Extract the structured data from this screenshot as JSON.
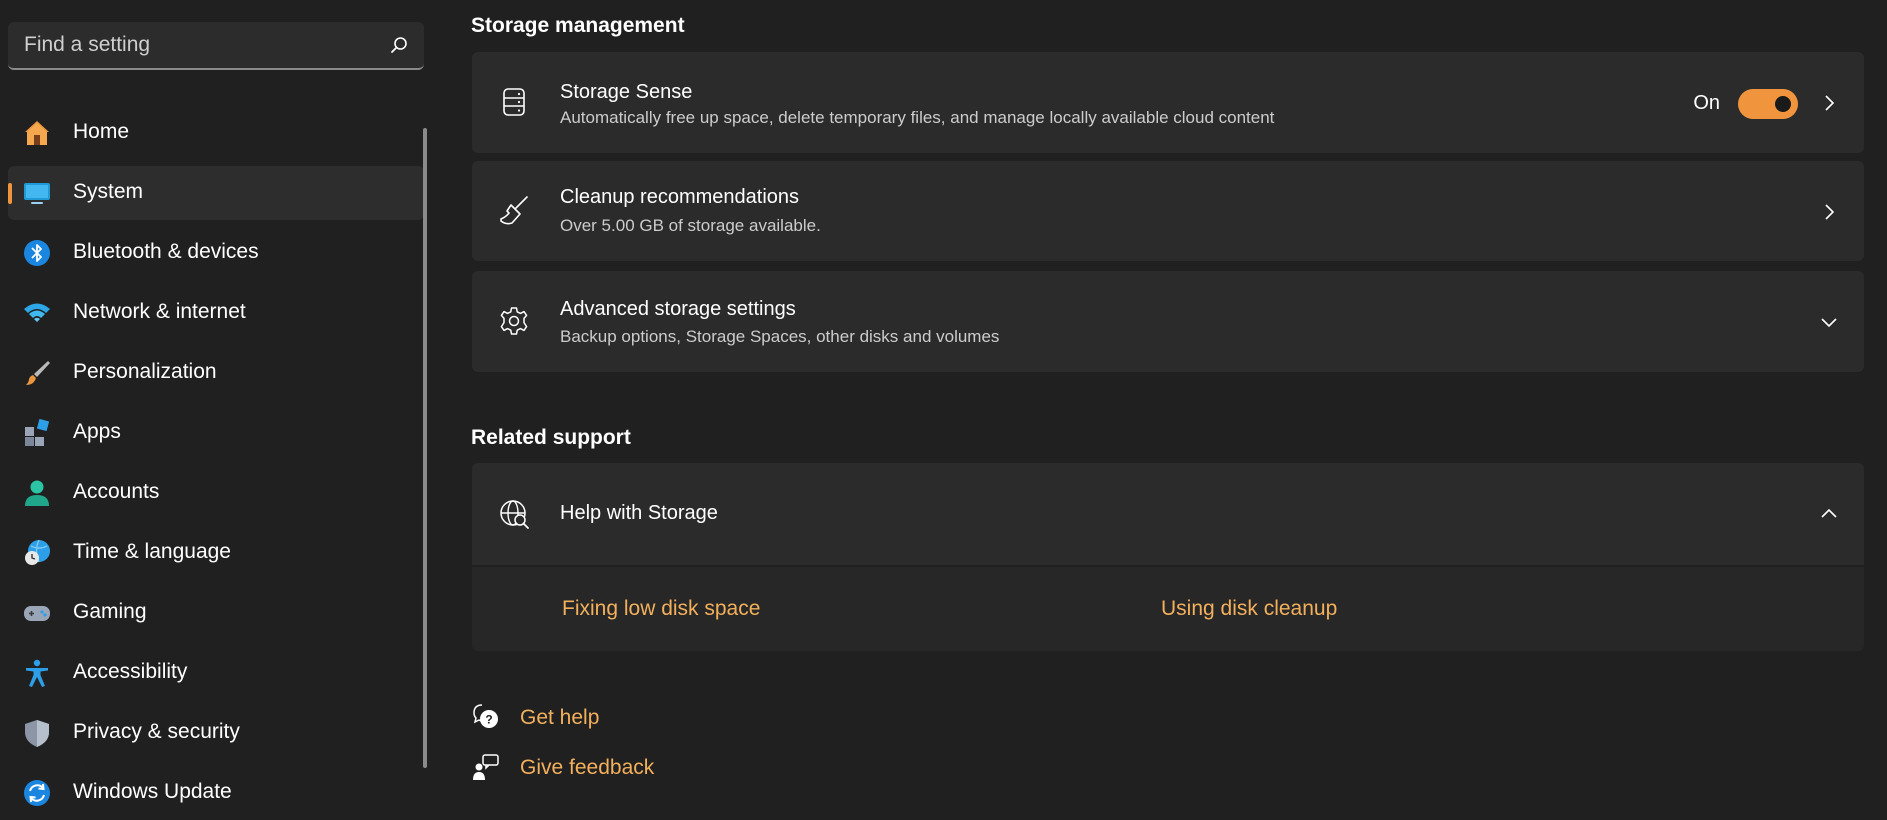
{
  "search": {
    "placeholder": "Find a setting"
  },
  "sidebar": {
    "items": [
      {
        "label": "Home",
        "icon": "home-icon"
      },
      {
        "label": "System",
        "icon": "system-icon",
        "selected": true
      },
      {
        "label": "Bluetooth & devices",
        "icon": "bluetooth-icon"
      },
      {
        "label": "Network & internet",
        "icon": "wifi-icon"
      },
      {
        "label": "Personalization",
        "icon": "brush-icon"
      },
      {
        "label": "Apps",
        "icon": "apps-icon"
      },
      {
        "label": "Accounts",
        "icon": "account-icon"
      },
      {
        "label": "Time & language",
        "icon": "globe-clock-icon"
      },
      {
        "label": "Gaming",
        "icon": "gamepad-icon"
      },
      {
        "label": "Accessibility",
        "icon": "accessibility-icon"
      },
      {
        "label": "Privacy & security",
        "icon": "shield-icon"
      },
      {
        "label": "Windows Update",
        "icon": "update-icon"
      }
    ]
  },
  "storage_management": {
    "title": "Storage management",
    "storage_sense": {
      "title": "Storage Sense",
      "description": "Automatically free up space, delete temporary files, and manage locally available cloud content",
      "toggle_label": "On"
    },
    "cleanup": {
      "title": "Cleanup recommendations",
      "description": "Over 5.00 GB of storage available."
    },
    "advanced": {
      "title": "Advanced storage settings",
      "description": "Backup options, Storage Spaces, other disks and volumes"
    }
  },
  "related_support": {
    "title": "Related support",
    "help": {
      "title": "Help with Storage",
      "links": [
        "Fixing low disk space",
        "Using disk cleanup"
      ]
    }
  },
  "footer": {
    "get_help": "Get help",
    "give_feedback": "Give feedback"
  },
  "colors": {
    "accent": "#f0953e",
    "link": "#f3b05c",
    "background": "#202020",
    "card": "#2b2b2b"
  }
}
